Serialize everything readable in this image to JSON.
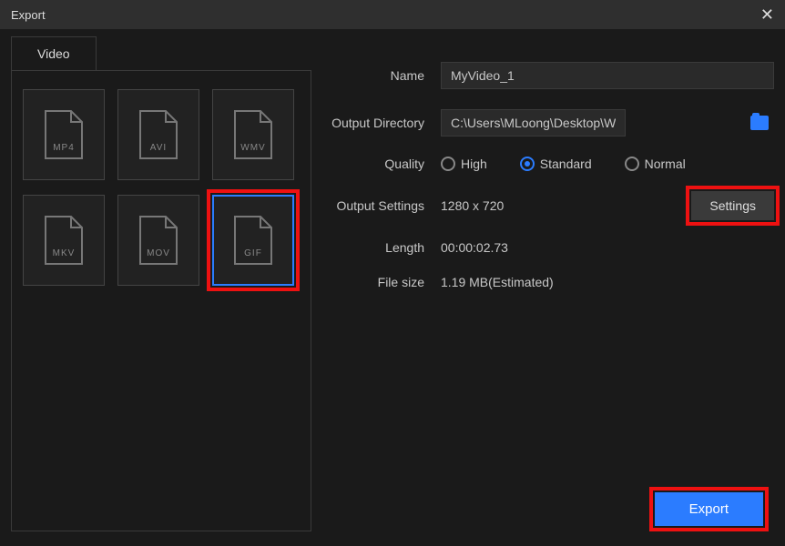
{
  "window": {
    "title": "Export"
  },
  "sidebar": {
    "tab_label": "Video",
    "formats": [
      "MP4",
      "AVI",
      "WMV",
      "MKV",
      "MOV",
      "GIF"
    ],
    "selected_index": 5
  },
  "form": {
    "name_label": "Name",
    "name_value": "MyVideo_1",
    "dir_label": "Output Directory",
    "dir_value": "C:\\Users\\MLoong\\Desktop\\WorkinTool\\",
    "quality_label": "Quality",
    "quality_options": [
      "High",
      "Standard",
      "Normal"
    ],
    "quality_selected": 1,
    "output_settings_label": "Output Settings",
    "output_settings_value": "1280 x 720",
    "settings_button": "Settings",
    "length_label": "Length",
    "length_value": "00:00:02.73",
    "filesize_label": "File size",
    "filesize_value": "1.19 MB(Estimated)"
  },
  "buttons": {
    "export": "Export"
  },
  "colors": {
    "accent": "#2b7cff",
    "highlight": "#e11111"
  }
}
